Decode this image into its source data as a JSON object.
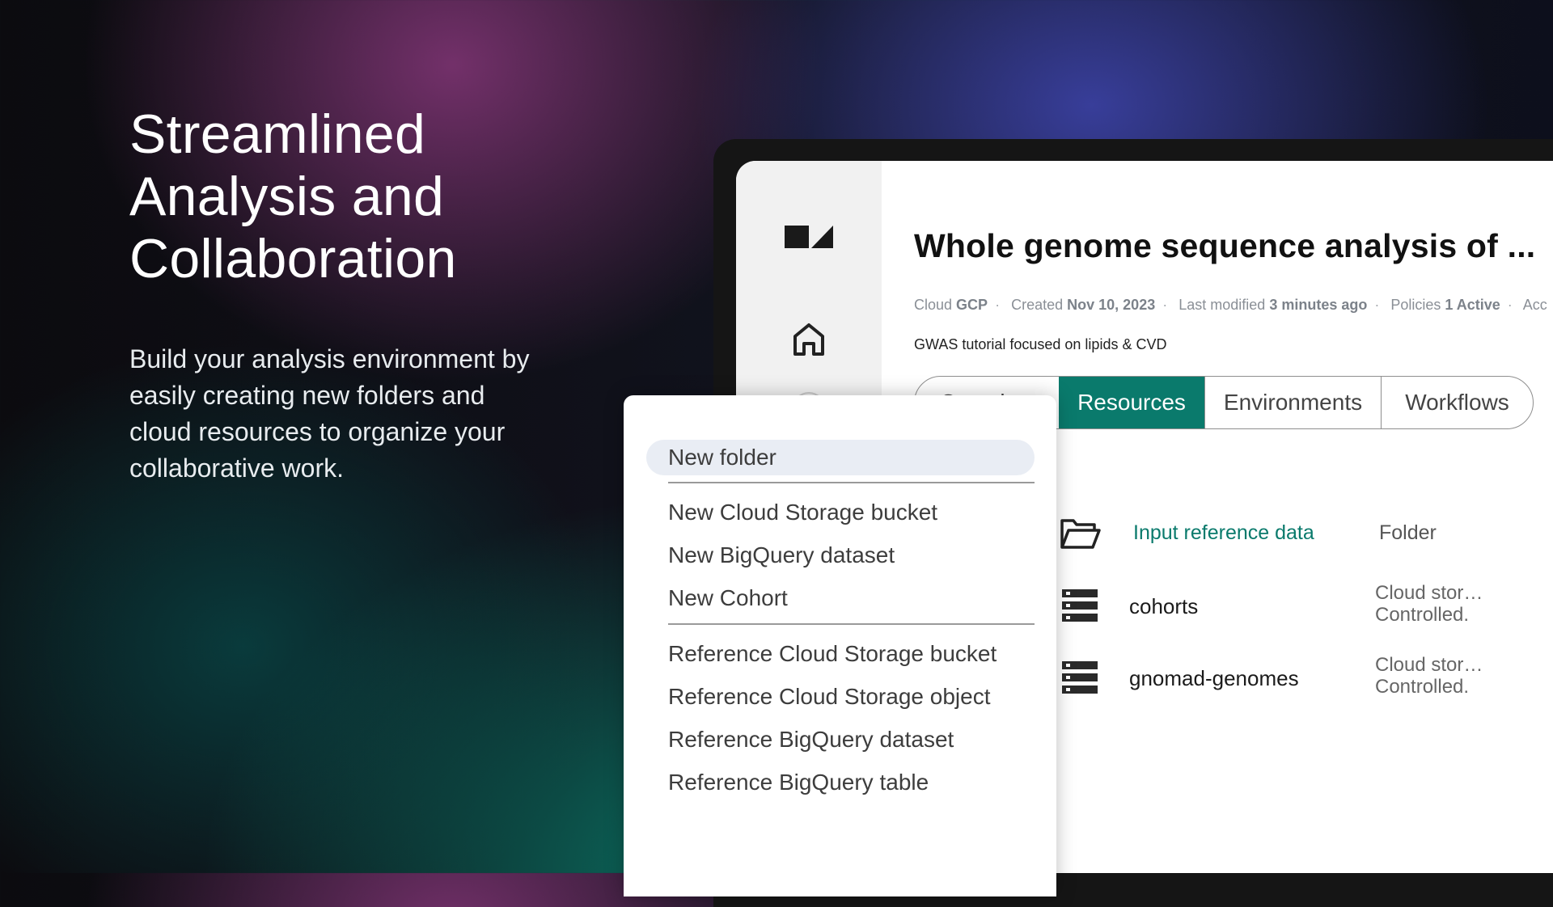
{
  "hero": {
    "title": "Streamlined\nAnalysis and\nCollaboration",
    "subtitle": "Build your analysis environment by\neasily creating new folders and\ncloud resources to organize your\ncollaborative work."
  },
  "workspace": {
    "title": "Whole genome sequence analysis of ...",
    "meta": {
      "cloud_label": "Cloud",
      "cloud_value": "GCP",
      "created_label": "Created",
      "created_value": "Nov 10, 2023",
      "modified_label": "Last modified",
      "modified_value": "3 minutes ago",
      "policies_label": "Policies",
      "policies_value": "1 Active",
      "access_label": "Acc"
    },
    "description": "GWAS tutorial focused on lipids & CVD",
    "tabs": [
      {
        "label": "Overview"
      },
      {
        "label": "Resources"
      },
      {
        "label": "Environments"
      },
      {
        "label": "Workflows"
      }
    ],
    "active_tab": "Resources",
    "resources": [
      {
        "name": "Input reference data",
        "type": "Folder",
        "icon": "folder-open-icon"
      },
      {
        "name": "cohorts",
        "type": "Cloud stor…\nControlled.",
        "icon": "database-icon"
      },
      {
        "name": "gnomad-genomes",
        "type": "Cloud stor…\nControlled.",
        "icon": "database-icon"
      }
    ]
  },
  "sidebar": {
    "logo": "logo-icon",
    "home": "home-icon"
  },
  "menu": {
    "items": [
      {
        "label": "New folder",
        "selected": true
      },
      {
        "label": "New Cloud Storage bucket"
      },
      {
        "label": "New BigQuery dataset"
      },
      {
        "label": "New Cohort"
      },
      {
        "label": "Reference Cloud Storage bucket"
      },
      {
        "label": "Reference Cloud Storage object"
      },
      {
        "label": "Reference BigQuery dataset"
      },
      {
        "label": "Reference BigQuery table"
      }
    ]
  },
  "colors": {
    "accent": "#0a7a6c",
    "menu_selected": "#e9edf4"
  }
}
